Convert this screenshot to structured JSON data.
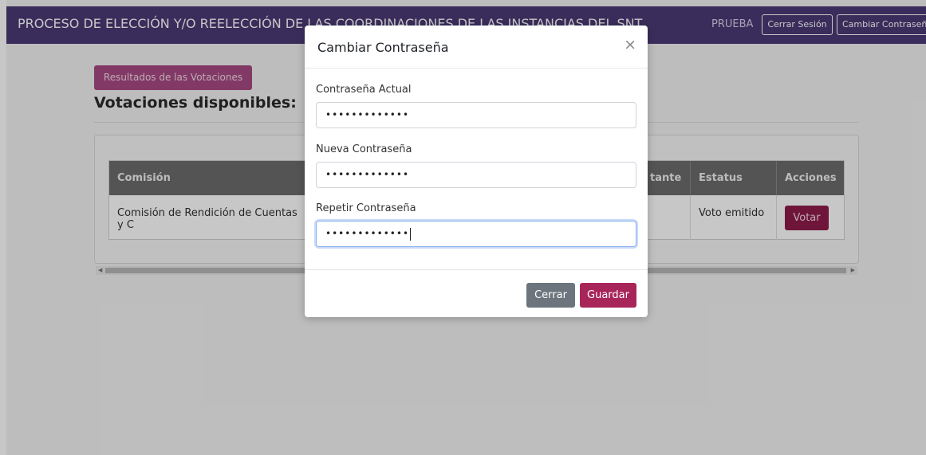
{
  "header": {
    "title": "PROCESO DE ELECCIÓN Y/O REELECCIÓN DE LAS COORDINACIONES DE LAS INSTANCIAS DEL SNT",
    "user": "PRUEBA",
    "logout_label": "Cerrar Sesión",
    "change_password_label": "Cambiar Contraseña"
  },
  "main": {
    "results_button": "Resultados de las Votaciones",
    "section_title": "Votaciones disponibles:",
    "table": {
      "columns": [
        "Comisión",
        "tante",
        "Estatus",
        "Acciones"
      ],
      "rows": [
        {
          "comision": "Comisión de Rendición de Cuentas y C",
          "estatus": "Voto emitido",
          "action": "Votar"
        }
      ]
    }
  },
  "modal": {
    "title": "Cambiar Contraseña",
    "close": "×",
    "fields": [
      {
        "label": "Contraseña Actual",
        "value": "•••••••••••••"
      },
      {
        "label": "Nueva Contraseña",
        "value": "•••••••••••••"
      },
      {
        "label": "Repetir Contraseña",
        "value": "•••••••••••••"
      }
    ],
    "cancel_label": "Cerrar",
    "save_label": "Guardar"
  },
  "colors": {
    "topbar": "#4b3a75",
    "accent": "#a8255a",
    "vote_button": "#8f1b4a",
    "results_button": "#a84a82",
    "table_header": "#6c6c6c"
  },
  "icons": {
    "close": "close-icon",
    "scroll_left": "arrow-left-icon",
    "scroll_right": "arrow-right-icon"
  }
}
